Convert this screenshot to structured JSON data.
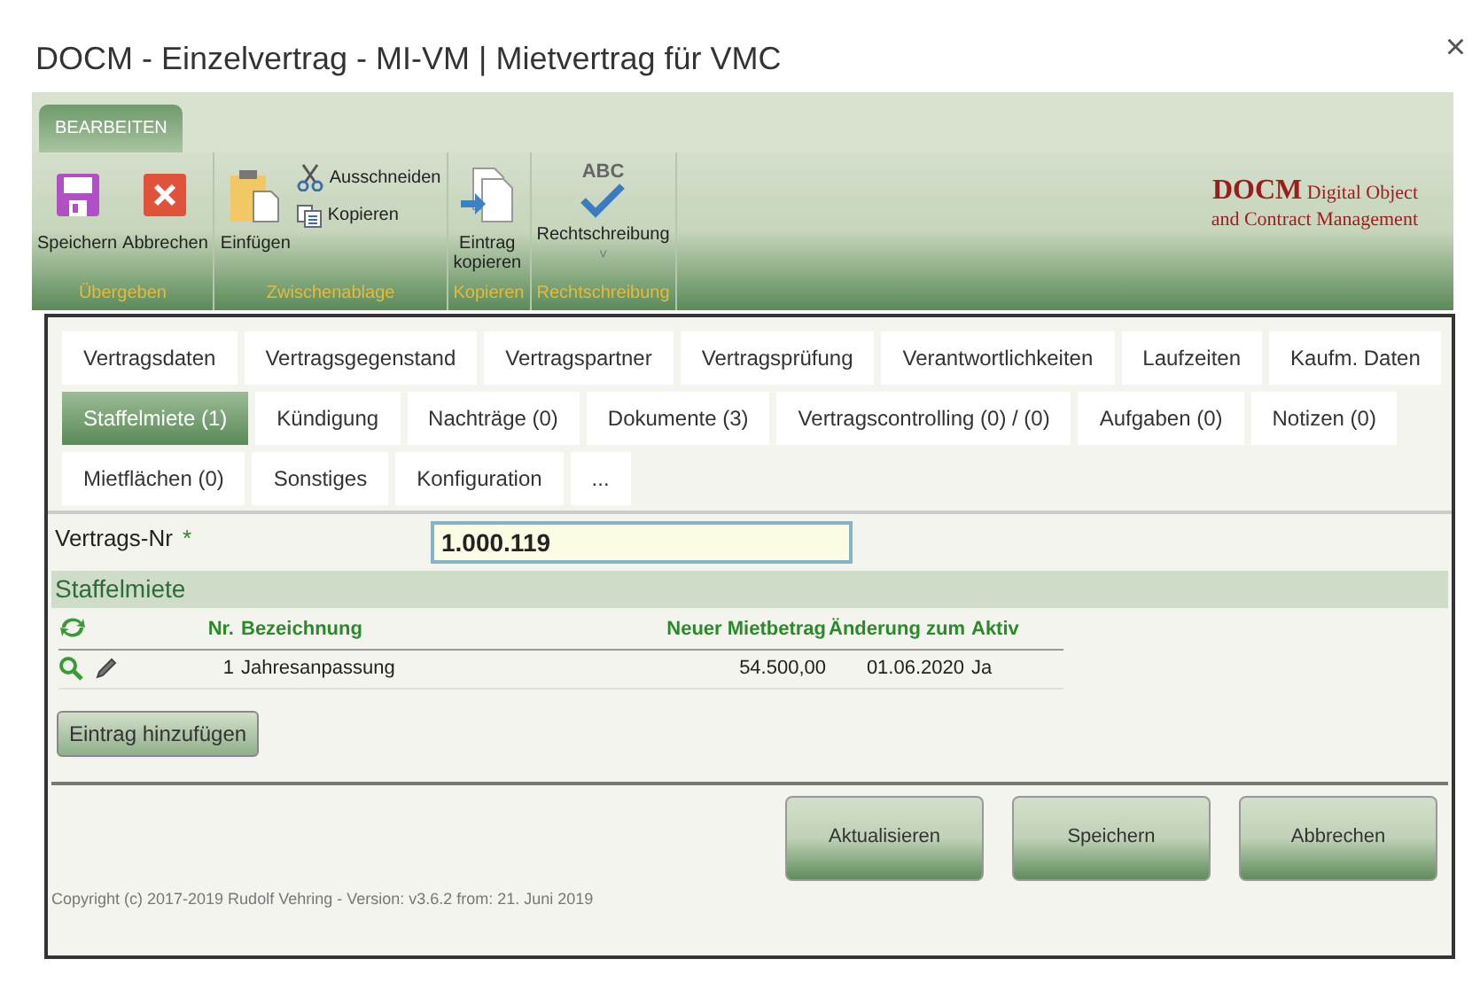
{
  "window": {
    "title": "DOCM - Einzelvertrag - MI-VM | Mietvertrag für VMC",
    "close": "×"
  },
  "ribbon": {
    "tabs": [
      {
        "label": "BEARBEITEN",
        "selected": true
      }
    ],
    "groups": [
      {
        "label": "Übergeben",
        "items": [
          {
            "kind": "large",
            "label": "Speichern"
          },
          {
            "kind": "large",
            "label": "Abbrechen"
          }
        ]
      },
      {
        "label": "Zwischenablage",
        "items": [
          {
            "kind": "large",
            "label": "Einfügen"
          },
          {
            "kind": "small",
            "label": "Ausschneiden"
          },
          {
            "kind": "small",
            "label": "Kopieren"
          }
        ]
      },
      {
        "label": "Kopieren",
        "items": [
          {
            "kind": "large",
            "label": "Eintrag kopieren"
          }
        ]
      },
      {
        "label": "Rechtschreibung",
        "items": [
          {
            "kind": "large",
            "icon_text": "ABC",
            "label": "Rechtschreibung",
            "caret": "˅"
          }
        ]
      }
    ],
    "logo": {
      "brand": "DOCM",
      "line1": "Digital Object",
      "line2": "and Contract Management"
    }
  },
  "tabs": [
    {
      "label": "Vertragsdaten",
      "selected": false
    },
    {
      "label": "Vertragsgegenstand",
      "selected": false
    },
    {
      "label": "Vertragspartner",
      "selected": false
    },
    {
      "label": "Vertragsprüfung",
      "selected": false
    },
    {
      "label": "Verantwortlichkeiten",
      "selected": false
    },
    {
      "label": "Laufzeiten",
      "selected": false
    },
    {
      "label": "Kaufm. Daten",
      "selected": false
    },
    {
      "label": "Staffelmiete (1)",
      "selected": true
    },
    {
      "label": "Kündigung",
      "selected": false
    },
    {
      "label": "Nachträge (0)",
      "selected": false
    },
    {
      "label": "Dokumente (3)",
      "selected": false
    },
    {
      "label": "Vertragscontrolling (0) / (0)",
      "selected": false
    },
    {
      "label": "Aufgaben (0)",
      "selected": false
    },
    {
      "label": "Notizen (0)",
      "selected": false
    },
    {
      "label": "Mietflächen (0)",
      "selected": false
    },
    {
      "label": "Sonstiges",
      "selected": false
    },
    {
      "label": "Konfiguration",
      "selected": false
    },
    {
      "label": "...",
      "selected": false
    }
  ],
  "contract_field": {
    "label": "Vertrags-Nr",
    "required_mark": "*",
    "value": "1.000.119"
  },
  "section": {
    "title": "Staffelmiete",
    "columns": [
      "Nr.",
      "Bezeichnung",
      "Neuer Mietbetrag",
      "Änderung zum",
      "Aktiv"
    ],
    "rows": [
      {
        "nr": "1",
        "bezeichnung": "Jahresanpassung",
        "betrag": "54.500,00",
        "datum": "01.06.2020",
        "aktiv": "Ja"
      }
    ],
    "add_button": "Eintrag hinzufügen"
  },
  "buttons": [
    "Aktualisieren",
    "Speichern",
    "Abbrechen"
  ],
  "footer": "Copyright (c) 2017-2019 Rudolf Vehring - Version: v3.6.2 from: 21. Juni 2019"
}
